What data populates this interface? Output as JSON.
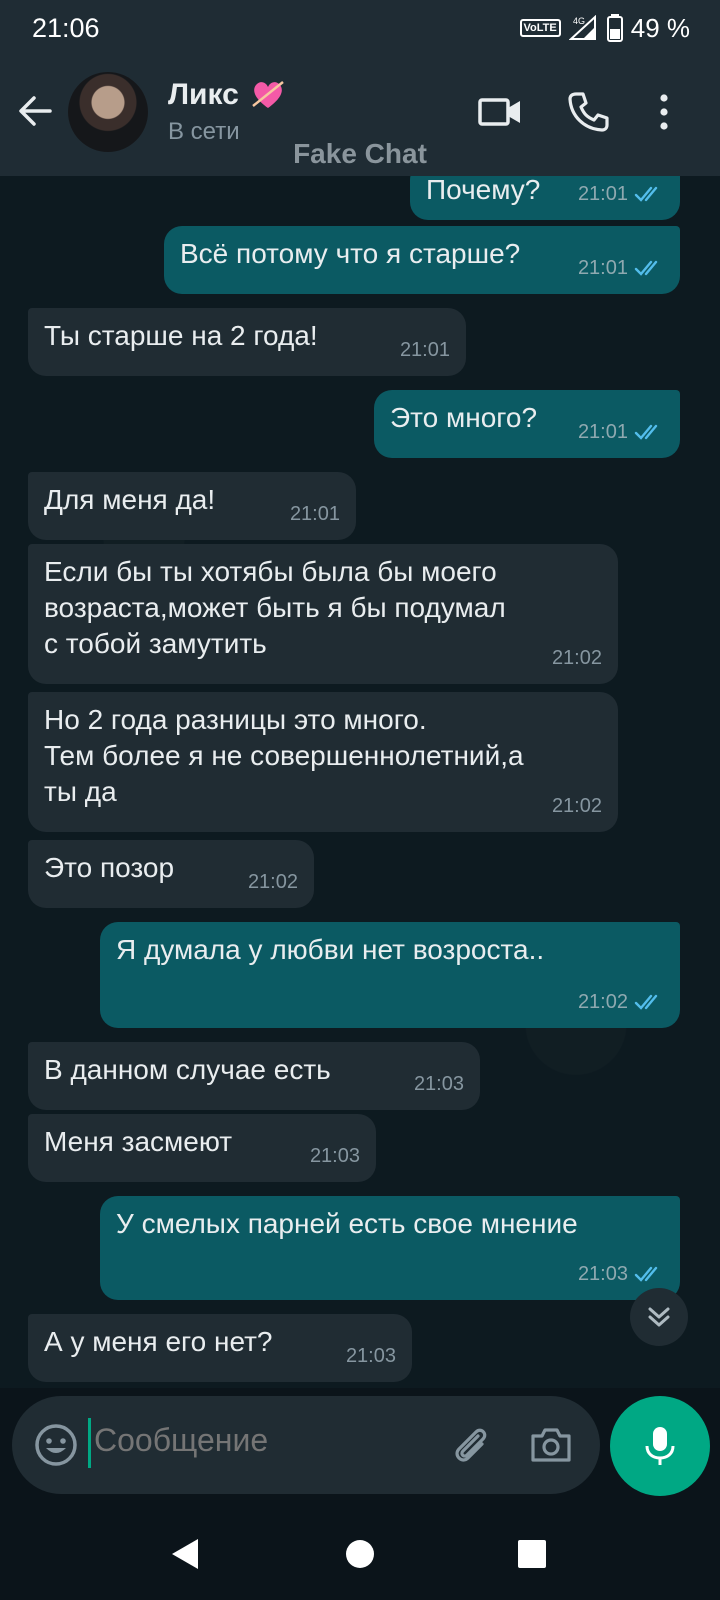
{
  "status_bar": {
    "time": "21:06",
    "network": "VoLTE",
    "signal": "4G",
    "battery": "49 %"
  },
  "header": {
    "contact_name": "Ликс",
    "status": "В сети",
    "watermark": "Fake Chat"
  },
  "messages": [
    {
      "dir": "out",
      "text": "Почему?",
      "time": "21:01",
      "read": true
    },
    {
      "dir": "out",
      "text": "Всё потому что я старше?",
      "time": "21:01",
      "read": true
    },
    {
      "dir": "in",
      "text": "Ты старше на 2 года!",
      "time": "21:01"
    },
    {
      "dir": "out",
      "text": "Это много?",
      "time": "21:01",
      "read": true
    },
    {
      "dir": "in",
      "text": "Для меня да!",
      "time": "21:01"
    },
    {
      "dir": "in",
      "text": "Если бы ты хотябы была бы моего\nвозраста,может быть я бы подумал\nс тобой замутить",
      "time": "21:02"
    },
    {
      "dir": "in",
      "text": "Но 2 года разницы это много.\nТем более я не совершеннолетний,а\nты да",
      "time": "21:02"
    },
    {
      "dir": "in",
      "text": "Это позор",
      "time": "21:02"
    },
    {
      "dir": "out",
      "text": "Я думала у любви нет возроста..",
      "time": "21:02",
      "read": true
    },
    {
      "dir": "in",
      "text": "В данном случае есть",
      "time": "21:03"
    },
    {
      "dir": "in",
      "text": "Меня засмеют",
      "time": "21:03"
    },
    {
      "dir": "out",
      "text": "У смелых парней есть свое мнение",
      "time": "21:03",
      "read": true
    },
    {
      "dir": "in",
      "text": "А у меня его нет?",
      "time": "21:03"
    }
  ],
  "composer": {
    "placeholder": "Сообщение"
  },
  "colors": {
    "accent": "#00a884",
    "outgoing_bubble": "#0b5a63",
    "incoming_bubble": "#202c33",
    "read_ticks": "#53bdeb"
  }
}
